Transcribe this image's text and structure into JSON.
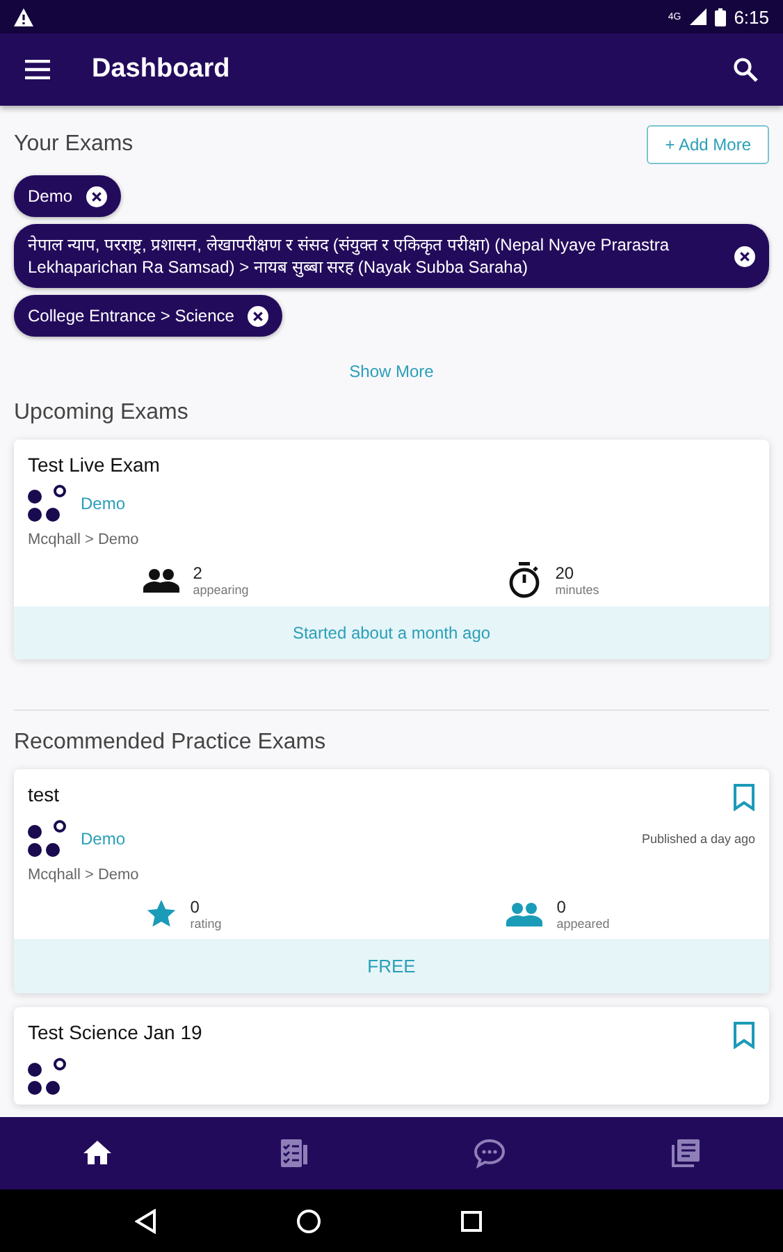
{
  "status_bar": {
    "time": "6:15",
    "network": "4G"
  },
  "app_bar": {
    "title": "Dashboard"
  },
  "your_exams": {
    "title": "Your Exams",
    "add_button": "+ Add More",
    "chips": [
      {
        "label": "Demo"
      },
      {
        "label": "नेपाल न्याप, परराष्ट्र, प्रशासन, लेखापरीक्षण र संसद (संयुक्त र एकिकृत परीक्षा) (Nepal Nyaye Prarastra Lekhaparichan Ra Samsad) > नायब सुब्बा  सरह (Nayak Subba Saraha)"
      },
      {
        "label": "College Entrance > Science"
      }
    ],
    "show_more": "Show More"
  },
  "upcoming": {
    "title": "Upcoming Exams",
    "cards": [
      {
        "title": "Test Live Exam",
        "org": "Demo",
        "path": "Mcqhall > Demo",
        "stats": [
          {
            "kind": "people",
            "value": "2",
            "label": "appearing"
          },
          {
            "kind": "timer",
            "value": "20",
            "label": "minutes"
          }
        ],
        "footer": "Started about a month ago"
      }
    ]
  },
  "recommended": {
    "title": "Recommended Practice Exams",
    "cards": [
      {
        "title": "test",
        "org": "Demo",
        "published": "Published a day ago",
        "path": "Mcqhall > Demo",
        "stats": [
          {
            "kind": "star",
            "value": "0",
            "label": "rating"
          },
          {
            "kind": "people-teal",
            "value": "0",
            "label": "appeared"
          }
        ],
        "footer": "FREE"
      },
      {
        "title": "Test Science Jan 19"
      }
    ]
  },
  "bottom_nav": [
    {
      "kind": "home",
      "selected": true
    },
    {
      "kind": "exams",
      "selected": false
    },
    {
      "kind": "chat",
      "selected": false
    },
    {
      "kind": "library",
      "selected": false
    }
  ]
}
